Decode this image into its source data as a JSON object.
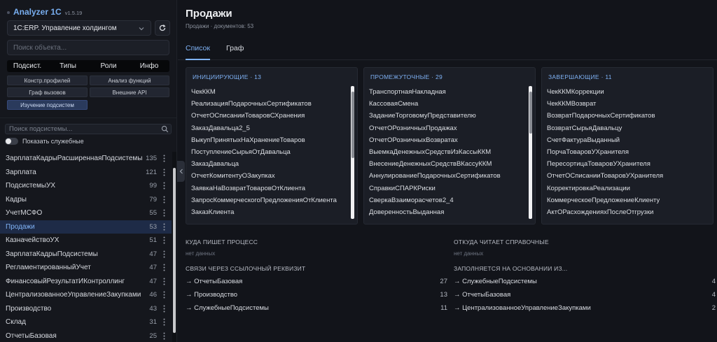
{
  "app": {
    "name": "Analyzer 1C",
    "version": "v1.5.19"
  },
  "config_select": {
    "value": "1C:ERP. Управление холдингом"
  },
  "object_search": {
    "placeholder": "Поиск объекта..."
  },
  "mode_tabs": [
    {
      "label": "Подсист."
    },
    {
      "label": "Типы"
    },
    {
      "label": "Роли"
    },
    {
      "label": "Инфо"
    }
  ],
  "tools": {
    "profiles": "Констр.профилей",
    "functions": "Анализ функций",
    "callgraph": "Граф вызовов",
    "external_api": "Внешние API",
    "subsystem_study": "Изучение подсистем"
  },
  "subsystem_search": {
    "placeholder": "Поиск подсистемы..."
  },
  "toggle_service": {
    "label": "Показать служебные"
  },
  "subsystems": [
    {
      "name": "ЗарплатаКадрыРасширеннаяПодсистемы",
      "count": "135"
    },
    {
      "name": "Зарплата",
      "count": "121"
    },
    {
      "name": "ПодсистемыУХ",
      "count": "99"
    },
    {
      "name": "Кадры",
      "count": "79"
    },
    {
      "name": "УчетМСФО",
      "count": "55"
    },
    {
      "name": "Продажи",
      "count": "53"
    },
    {
      "name": "КазначействоУХ",
      "count": "51"
    },
    {
      "name": "ЗарплатаКадрыПодсистемы",
      "count": "47"
    },
    {
      "name": "РегламентированныйУчет",
      "count": "47"
    },
    {
      "name": "ФинансовыйРезультатИКонтроллинг",
      "count": "47"
    },
    {
      "name": "ЦентрализованноеУправлениеЗакупками",
      "count": "46"
    },
    {
      "name": "Производство",
      "count": "43"
    },
    {
      "name": "Склад",
      "count": "31"
    },
    {
      "name": "ОтчетыБазовая",
      "count": "25"
    }
  ],
  "page": {
    "title": "Продажи",
    "subtitle": "Продажи · документов: 53"
  },
  "view_tabs": [
    {
      "label": "Список"
    },
    {
      "label": "Граф"
    }
  ],
  "panels": {
    "initiating": {
      "title": "ИНИЦИИРУЮЩИЕ · 13",
      "items": [
        "ЧекККМ",
        "РеализацияПодарочныхСертификатов",
        "ОтчетОСписанииТоваровСХранения",
        "ЗаказДавальца2_5",
        "ВыкупПринятыхНаХранениеТоваров",
        "ПоступлениеСырьяОтДавальца",
        "ЗаказДавальца",
        "ОтчетКомитентуОЗакупках",
        "ЗаявкаНаВозвратТоваровОтКлиента",
        "ЗапросКоммерческогоПредложенияОтКлиента",
        "ЗаказКлиента"
      ]
    },
    "intermediate": {
      "title": "ПРОМЕЖУТОЧНЫЕ · 29",
      "items": [
        "ТранспортнаяНакладная",
        "КассоваяСмена",
        "ЗаданиеТорговомуПредставителю",
        "ОтчетОРозничныхПродажах",
        "ОтчетОРозничныхВозвратах",
        "ВыемкаДенежныхСредствИзКассыККМ",
        "ВнесениеДенежныхСредствВКассуККМ",
        "АннулированиеПодарочныхСертификатов",
        "СправкиСПАРКРиски",
        "СверкаВзаиморасчетов2_4",
        "ДоверенностьВыданная"
      ]
    },
    "final": {
      "title": "ЗАВЕРШАЮЩИЕ · 11",
      "items": [
        "ЧекККМКоррекции",
        "ЧекККМВозврат",
        "ВозвратПодарочныхСертификатов",
        "ВозвратСырьяДавальцу",
        "СчетФактураВыданный",
        "ПорчаТоваровУХранителя",
        "ПересортицаТоваровУХранителя",
        "ОтчетОСписанииТоваровУХранителя",
        "КорректировкаРеализации",
        "КоммерческоеПредложениеКлиенту",
        "АктОРасхожденияхПослеОтгрузки"
      ]
    }
  },
  "writes_to": {
    "title": "КУДА ПИШЕТ ПРОЦЕСС",
    "empty": "нет данных"
  },
  "reads_from": {
    "title": "ОТКУДА ЧИТАЕТ СПРАВОЧНЫЕ",
    "empty": "нет данных"
  },
  "ref_links": {
    "title": "СВЯЗИ ЧЕРЕЗ ССЫЛОЧНЫЙ РЕКВИЗИТ",
    "rows": [
      {
        "label": "→ ОтчетыБазовая",
        "count": "27"
      },
      {
        "label": "→ Производство",
        "count": "13"
      },
      {
        "label": "→ СлужебныеПодсистемы",
        "count": "11"
      }
    ]
  },
  "based_on": {
    "title": "ЗАПОЛНЯЕТСЯ НА ОСНОВАНИИ ИЗ...",
    "rows": [
      {
        "label": "→ СлужебныеПодсистемы",
        "count": "4"
      },
      {
        "label": "→ ОтчетыБазовая",
        "count": "4"
      },
      {
        "label": "→ ЦентрализованноеУправлениеЗакупками",
        "count": "2"
      }
    ]
  },
  "colors": {
    "accent": "#7fb2f5",
    "background": "#12141a",
    "sidebar": "#15171d",
    "panel": "#1b1e26",
    "active_item": "#1e2b47"
  }
}
